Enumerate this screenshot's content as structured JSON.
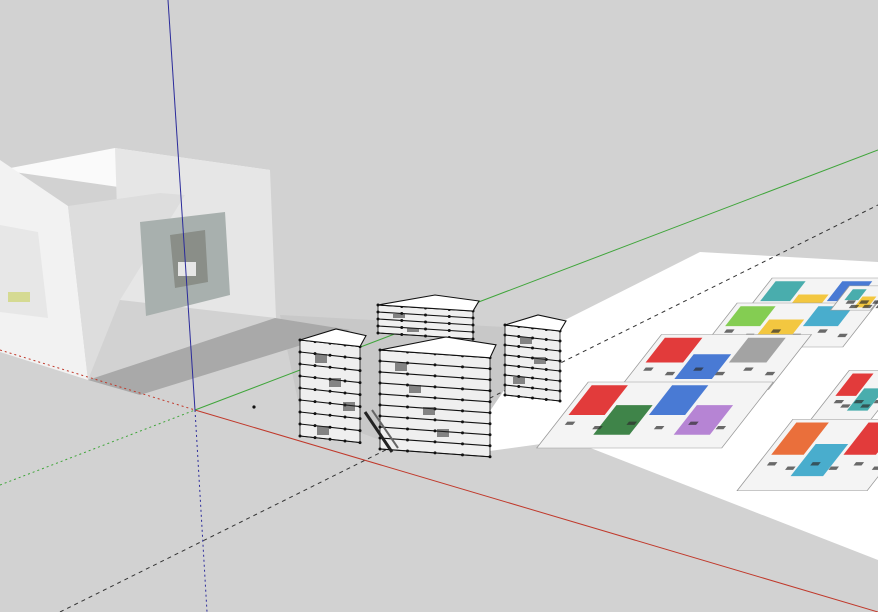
{
  "app": {
    "type": "3d-modeling-viewport",
    "view": "perspective"
  },
  "colors": {
    "background": "#d2d2d2",
    "ground_shadow": "#c4c4c4",
    "axis_red": "#c0392b",
    "axis_green": "#3fa53a",
    "axis_blue": "#2b2b9b",
    "sheet_white": "#ffffff",
    "wall_front": "#f2f2f2",
    "wall_side": "#e6e6e6",
    "wall_shadow": "#a8a8a8",
    "model_edge": "#111111",
    "model_face": "#ffffff",
    "model_side": "#e9e9e9"
  },
  "axes": [
    {
      "name": "red-axis",
      "color_key": "axis_red"
    },
    {
      "name": "green-axis",
      "color_key": "axis_green"
    },
    {
      "name": "blue-axis",
      "color_key": "axis_blue"
    }
  ],
  "model": {
    "blocks": [
      {
        "name": "tower-left",
        "levels": 8
      },
      {
        "name": "tower-back",
        "levels": 4
      },
      {
        "name": "tower-center",
        "levels": 9
      },
      {
        "name": "tower-right",
        "levels": 7
      }
    ]
  },
  "plan_sheet": {
    "tiles": [
      {
        "name": "plan-tile-1",
        "accent": [
          "#3aa6a6",
          "#f2c230",
          "#3a6fd0"
        ]
      },
      {
        "name": "plan-tile-2",
        "accent": [
          "#7ac943",
          "#f2c230",
          "#3aa6c9"
        ]
      },
      {
        "name": "plan-tile-3",
        "accent": [
          "#e02a2a",
          "#3a6fd0",
          "#9b9b9b"
        ]
      },
      {
        "name": "plan-tile-4",
        "accent": [
          "#e02a2a",
          "#2f7a3a",
          "#3a6fd0",
          "#b07ad0"
        ]
      },
      {
        "name": "plan-tile-5",
        "accent": [
          "#e02a2a",
          "#3aa6a6"
        ]
      },
      {
        "name": "plan-tile-6",
        "accent": [
          "#e8632a",
          "#3aa6c9",
          "#e02a2a"
        ]
      },
      {
        "name": "plan-tile-7",
        "accent": [
          "#3aa6a6",
          "#f2c230"
        ]
      }
    ]
  }
}
